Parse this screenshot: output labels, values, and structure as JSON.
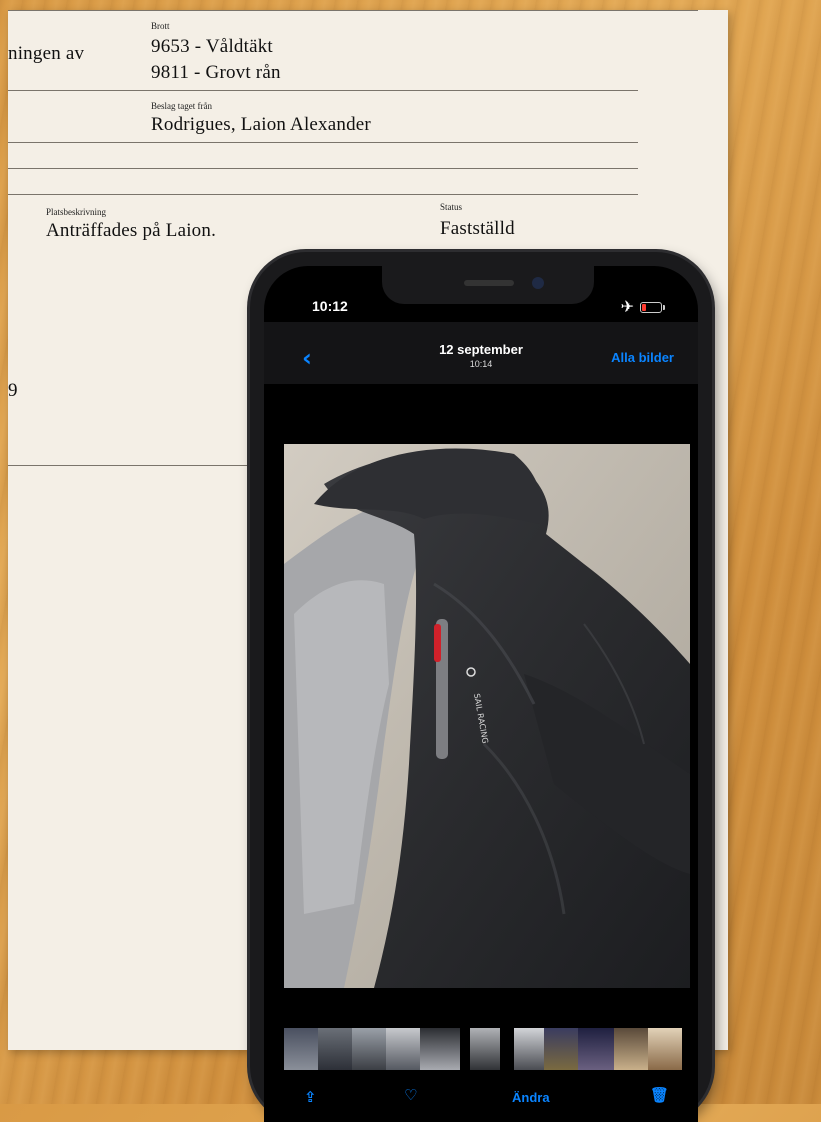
{
  "document": {
    "crime_label": "Brott",
    "partial_text": "ningen av",
    "crimes": [
      "9653  -  Våldtäkt",
      "9811  -  Grovt rån"
    ],
    "seized_from_label": "Beslag taget från",
    "seized_from": "Rodrigues, Laion Alexander",
    "location_label": "Platsbeskrivning",
    "location": "Anträffades på Laion.",
    "status_label": "Status",
    "status": "Fastställd",
    "margin_digit": "9"
  },
  "phone": {
    "status_bar": {
      "time": "10:12",
      "airplane_icon": "airplane-icon",
      "battery_icon": "battery-low-icon",
      "battery_color": "#ff3b30"
    },
    "nav": {
      "back_icon": "chevron-left-icon",
      "date": "12 september",
      "time": "10:14",
      "action": "Alla bilder",
      "accent": "#0a84ff"
    },
    "photo": {
      "subject": "jacket-photo"
    },
    "toolbar": {
      "share_icon": "share-icon",
      "favorite_icon": "heart-icon",
      "edit_label": "Ändra",
      "delete_icon": "trash-icon"
    }
  }
}
